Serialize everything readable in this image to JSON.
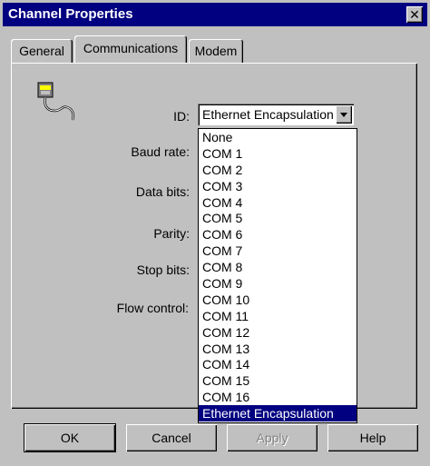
{
  "window": {
    "title": "Channel Properties",
    "close_glyph": "✕"
  },
  "tabs": [
    {
      "label": "General"
    },
    {
      "label": "Communications"
    },
    {
      "label": "Modem"
    }
  ],
  "form": {
    "id_label": "ID:",
    "baud_label": "Baud rate:",
    "data_label": "Data bits:",
    "parity_label": "Parity:",
    "stop_label": "Stop bits:",
    "flow_label": "Flow control:",
    "id_value": "Ethernet Encapsulation"
  },
  "dropdown": {
    "options": [
      "None",
      "COM 1",
      "COM 2",
      "COM 3",
      "COM 4",
      "COM 5",
      "COM 6",
      "COM 7",
      "COM 8",
      "COM 9",
      "COM 10",
      "COM 11",
      "COM 12",
      "COM 13",
      "COM 14",
      "COM 15",
      "COM 16",
      "Ethernet Encapsulation"
    ],
    "selected": "Ethernet Encapsulation"
  },
  "buttons": {
    "ok": "OK",
    "cancel": "Cancel",
    "apply": "Apply",
    "help": "Help"
  },
  "icons": {
    "port": "serial-port-cable-icon"
  },
  "colors": {
    "titlebar": "#000080",
    "selection": "#000080",
    "face": "#c0c0c0"
  }
}
